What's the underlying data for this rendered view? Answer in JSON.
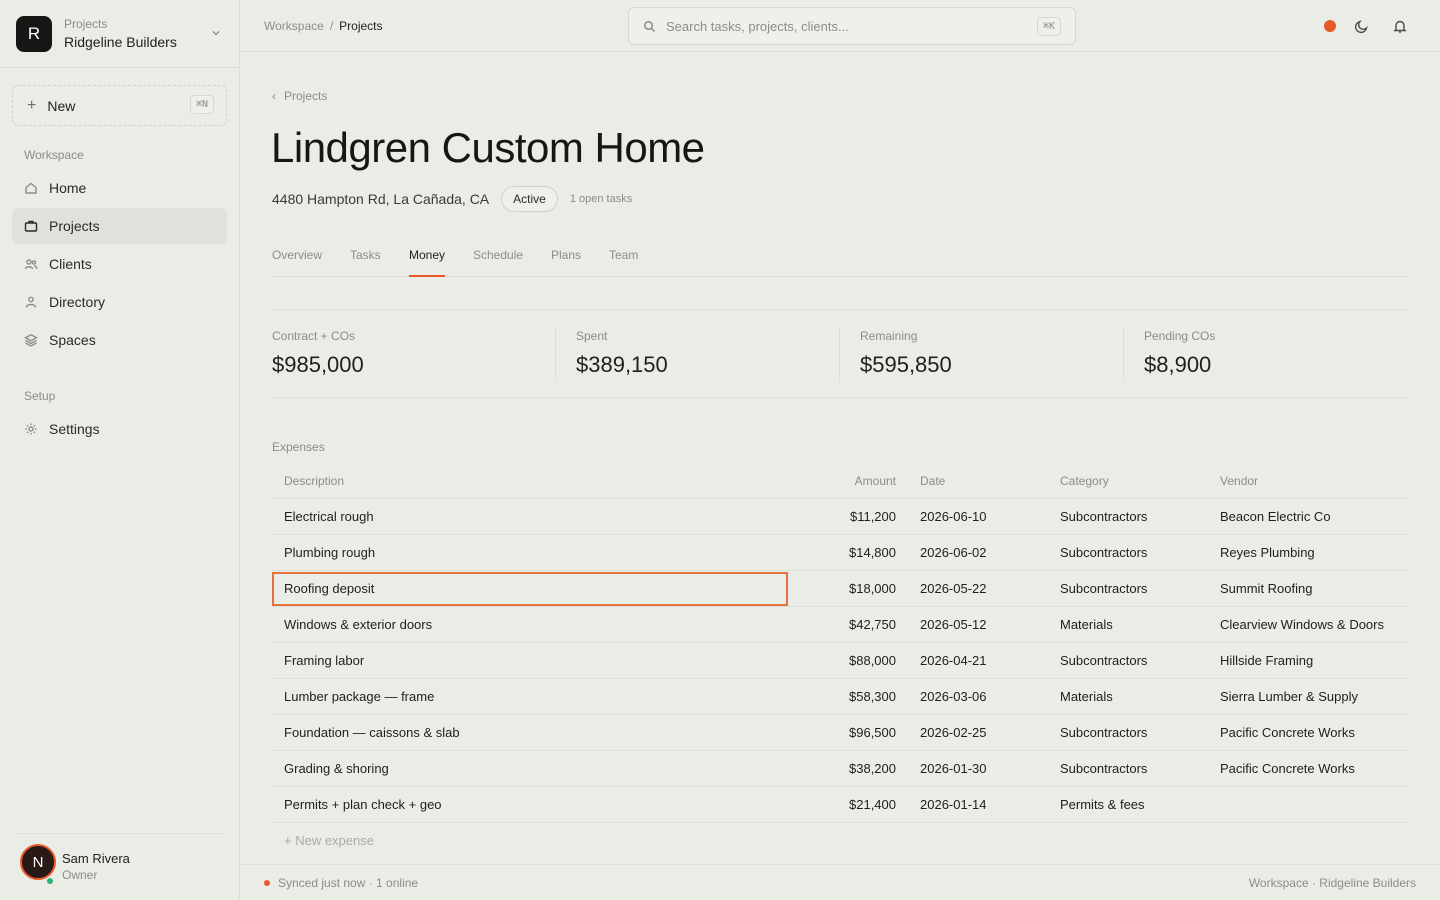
{
  "org": {
    "kicker": "Projects",
    "name": "Ridgeline Builders",
    "logo_letter": "R"
  },
  "sidebar": {
    "new_label": "New",
    "new_shortcut": "⌘N",
    "workspace_heading": "Workspace",
    "items": [
      {
        "label": "Home",
        "icon": "home-icon"
      },
      {
        "label": "Projects",
        "icon": "briefcase-icon",
        "active": true
      },
      {
        "label": "Clients",
        "icon": "users-icon"
      },
      {
        "label": "Directory",
        "icon": "user-icon"
      },
      {
        "label": "Spaces",
        "icon": "layers-icon"
      }
    ],
    "setup_heading": "Setup",
    "setup_items": [
      {
        "label": "Settings",
        "icon": "gear-icon"
      }
    ]
  },
  "user": {
    "initial": "N",
    "name": "Sam Rivera",
    "role": "Owner"
  },
  "topbar": {
    "breadcrumb": [
      "Workspace",
      "Projects"
    ],
    "search_placeholder": "Search tasks, projects, clients...",
    "search_shortcut": "⌘K"
  },
  "page": {
    "back_label": "Projects",
    "title": "Lindgren Custom Home",
    "address": "4480 Hampton Rd, La Cañada, CA",
    "status": "Active",
    "open_tasks": "1 open tasks",
    "tabs": [
      "Overview",
      "Tasks",
      "Money",
      "Schedule",
      "Plans",
      "Team"
    ],
    "active_tab": "Money"
  },
  "stats": [
    {
      "label": "Contract + COs",
      "value": "$985,000"
    },
    {
      "label": "Spent",
      "value": "$389,150"
    },
    {
      "label": "Remaining",
      "value": "$595,850"
    },
    {
      "label": "Pending COs",
      "value": "$8,900"
    }
  ],
  "expenses": {
    "heading": "Expenses",
    "columns": {
      "description": "Description",
      "amount": "Amount",
      "date": "Date",
      "category": "Category",
      "vendor": "Vendor"
    },
    "rows": [
      {
        "description": "Electrical rough",
        "amount": "$11,200",
        "date": "2026-06-10",
        "category": "Subcontractors",
        "vendor": "Beacon Electric Co"
      },
      {
        "description": "Plumbing rough",
        "amount": "$14,800",
        "date": "2026-06-02",
        "category": "Subcontractors",
        "vendor": "Reyes Plumbing"
      },
      {
        "description": "Roofing deposit",
        "amount": "$18,000",
        "date": "2026-05-22",
        "category": "Subcontractors",
        "vendor": "Summit Roofing",
        "selected": true
      },
      {
        "description": "Windows & exterior doors",
        "amount": "$42,750",
        "date": "2026-05-12",
        "category": "Materials",
        "vendor": "Clearview Windows & Doors"
      },
      {
        "description": "Framing labor",
        "amount": "$88,000",
        "date": "2026-04-21",
        "category": "Subcontractors",
        "vendor": "Hillside Framing"
      },
      {
        "description": "Lumber package — frame",
        "amount": "$58,300",
        "date": "2026-03-06",
        "category": "Materials",
        "vendor": "Sierra Lumber & Supply"
      },
      {
        "description": "Foundation — caissons & slab",
        "amount": "$96,500",
        "date": "2026-02-25",
        "category": "Subcontractors",
        "vendor": "Pacific Concrete Works"
      },
      {
        "description": "Grading & shoring",
        "amount": "$38,200",
        "date": "2026-01-30",
        "category": "Subcontractors",
        "vendor": "Pacific Concrete Works"
      },
      {
        "description": "Permits + plan check + geo",
        "amount": "$21,400",
        "date": "2026-01-14",
        "category": "Permits & fees",
        "vendor": ""
      }
    ],
    "new_label": "+ New expense"
  },
  "statusbar": {
    "sync": "Synced just now · 1 online",
    "right": "Workspace · Ridgeline Builders"
  },
  "colors": {
    "accent": "#e8582a",
    "background": "#eaece6",
    "online": "#2bb673"
  }
}
